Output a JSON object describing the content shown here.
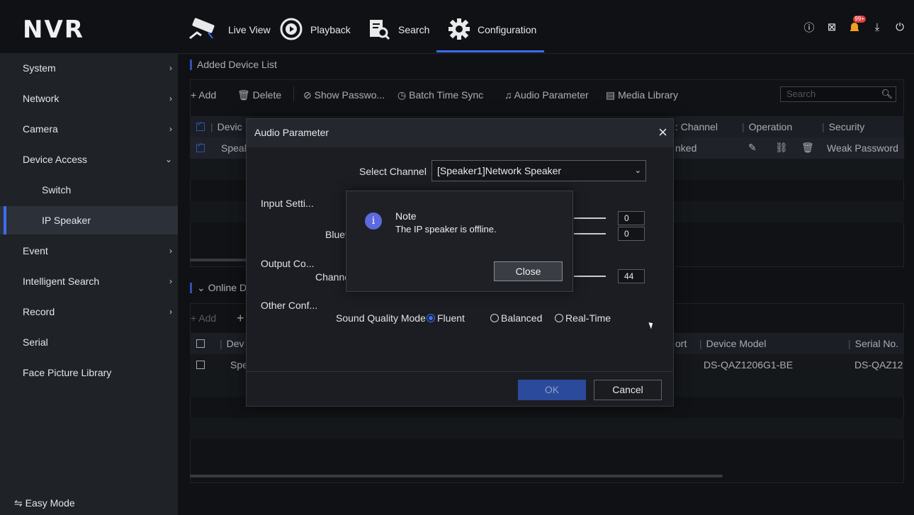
{
  "app": {
    "logo": "NVR"
  },
  "nav": {
    "items": [
      {
        "label": "Live View"
      },
      {
        "label": "Playback"
      },
      {
        "label": "Search"
      },
      {
        "label": "Configuration"
      }
    ],
    "badge": "99+"
  },
  "sidebar": {
    "items": [
      {
        "label": "System"
      },
      {
        "label": "Network"
      },
      {
        "label": "Camera"
      },
      {
        "label": "Device Access"
      },
      {
        "label": "Switch"
      },
      {
        "label": "IP Speaker"
      },
      {
        "label": "Event"
      },
      {
        "label": "Intelligent Search"
      },
      {
        "label": "Record"
      },
      {
        "label": "Serial"
      },
      {
        "label": "Face Picture Library"
      }
    ],
    "easy_mode": "⇋ Easy Mode"
  },
  "added": {
    "title": "Added Device List",
    "toolbar": {
      "add": "+ Add",
      "delete": "Delete",
      "show_password": "Show Passwo...",
      "batch_time_sync": "Batch Time Sync",
      "audio_parameter": "Audio Parameter",
      "media_library": "Media Library"
    },
    "search_placeholder": "Search",
    "headers": {
      "device": "Devic",
      "channel": ": Channel",
      "operation": "Operation",
      "security": "Security"
    },
    "row": {
      "device": "Speak",
      "channel": "nked",
      "security": "Weak Password"
    }
  },
  "online": {
    "title": "Online D",
    "toolbar": {
      "add": "+ Add",
      "plus": "+"
    },
    "headers": {
      "device": "Dev",
      "port": "ort",
      "model": "Device Model",
      "serial": "Serial No."
    },
    "row": {
      "device": "Spe",
      "model": "DS-QAZ1206G1-BE",
      "serial": "DS-QAZ12"
    }
  },
  "dialog": {
    "title": "Audio Parameter",
    "select_channel_label": "Select Channel",
    "select_channel_value": "[Speaker1]Network Speaker",
    "input_settings": "Input Setti...",
    "bluetooth_label": "Bluet",
    "input_value_1": "0",
    "input_value_2": "0",
    "output_config": "Output Co...",
    "channel_label": "Channe",
    "output_value": "44",
    "other_config": "Other Conf...",
    "sound_quality_label": "Sound Quality Mode",
    "sound_options": [
      "Fluent",
      "Balanced",
      "Real-Time"
    ],
    "ok": "OK",
    "cancel": "Cancel"
  },
  "note": {
    "title": "Note",
    "message": "The IP speaker is offline.",
    "close": "Close"
  }
}
